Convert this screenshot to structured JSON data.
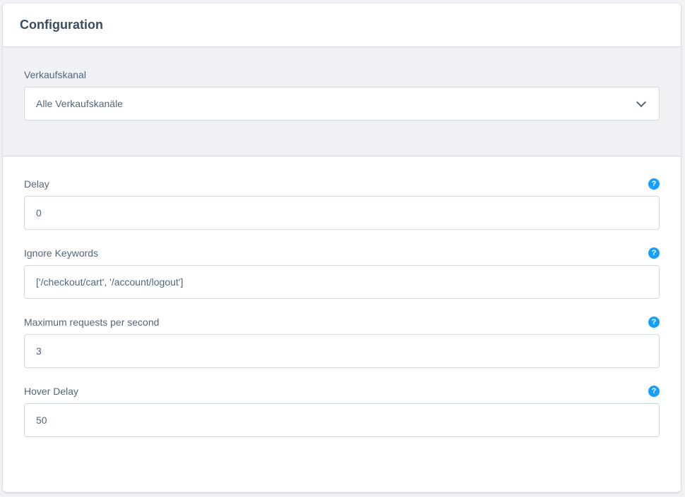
{
  "card": {
    "title": "Configuration"
  },
  "sales_channel": {
    "label": "Verkaufskanal",
    "selected": "Alle Verkaufskanäle",
    "icon": "chevron-down-icon"
  },
  "fields": [
    {
      "label": "Delay",
      "value": "0",
      "help_icon": "?"
    },
    {
      "label": "Ignore Keywords",
      "value": "['/checkout/cart', '/account/logout']",
      "help_icon": "?"
    },
    {
      "label": "Maximum requests per second",
      "value": "3",
      "help_icon": "?"
    },
    {
      "label": "Hover Delay",
      "value": "50",
      "help_icon": "?"
    }
  ],
  "colors": {
    "accent": "#189eff",
    "section_bg": "#eff1f4",
    "text": "#52667a",
    "border": "#d1d9e0"
  }
}
